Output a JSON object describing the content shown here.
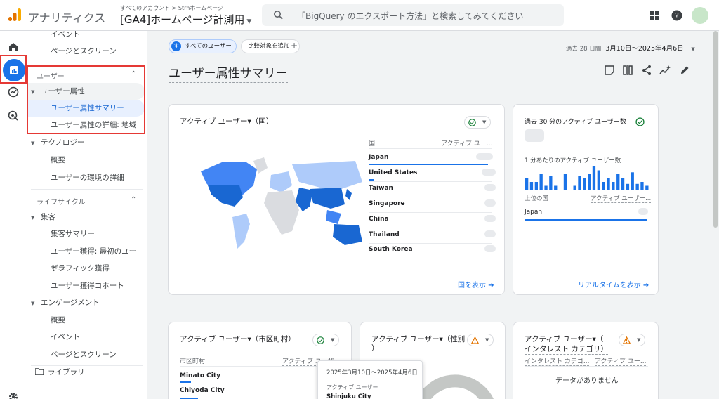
{
  "header": {
    "app_title": "アナリティクス",
    "breadcrumb": "すべてのアカウント > Strhホームページ",
    "property": "[GA4]ホームページ計測用",
    "search_placeholder": "「BigQuery のエクスポート方法」と検索してみてください"
  },
  "nav": {
    "items_top": [
      "イベント",
      "ページとスクリーン"
    ],
    "user_section": "ユーザー",
    "user_attr": "ユーザー属性",
    "user_attr_summary": "ユーザー属性サマリー",
    "user_attr_detail": "ユーザー属性の詳細: 地域",
    "technology": "テクノロジー",
    "tech_overview": "概要",
    "tech_env": "ユーザーの環境の詳細",
    "lifecycle": "ライフサイクル",
    "acquisition": "集客",
    "acq_summary": "集客サマリー",
    "acq_user": "ユーザー獲得: 最初のユーザ...",
    "acq_traffic": "トラフィック獲得",
    "acq_cohort": "ユーザー獲得コホート",
    "engagement": "エンゲージメント",
    "eng_overview": "概要",
    "eng_events": "イベント",
    "eng_pages": "ページとスクリーン",
    "library": "ライブラリ"
  },
  "toolbar": {
    "chip_all_users_letter": "す",
    "chip_all_users": "すべてのユーザー",
    "chip_compare": "比較対象を追加",
    "date_prefix": "過去 28 日間",
    "date_range": "3月10日～2025年4月6日",
    "page_title": "ユーザー属性サマリー"
  },
  "country_card": {
    "title": "アクティブ ユーザー▾（国）",
    "col_country": "国",
    "col_users": "アクティブ ユー...",
    "rows": [
      "Japan",
      "United States",
      "Taiwan",
      "Singapore",
      "China",
      "Thailand",
      "South Korea"
    ],
    "link": "国を表示"
  },
  "realtime_card": {
    "title": "過去 30 分のアクティブ ユーザー数",
    "per_minute": "1 分あたりのアクティブ ユーザー数",
    "col_country": "上位の国",
    "col_users": "アクティブ ユーザー...",
    "row": "Japan",
    "link": "リアルタイムを表示"
  },
  "city_card": {
    "title": "アクティブ ユーザー▾（市区町村）",
    "col_city": "市区町村",
    "col_users": "アクティブ ユーザー",
    "rows": [
      "Minato City",
      "Chiyoda City"
    ]
  },
  "gender_card": {
    "title": "アクティブ ユーザー▾（性別",
    "title2": "）"
  },
  "interest_card": {
    "title": "アクティブ ユーザー▾（",
    "title2": "インタレスト カテゴリ）",
    "col_cat": "インタレスト カテゴ...",
    "col_users": "アクティブ ユー...",
    "empty": "データがありません"
  },
  "tooltip": {
    "date": "2025年3月10日～2025年4月6日",
    "metric": "アクティブ ユーザー",
    "city": "Shinjuku City"
  },
  "colors": {
    "accent": "#1a73e8",
    "highlight": "#e53935"
  },
  "realtime_bars": [
    6,
    4,
    4,
    8,
    2,
    7,
    2,
    0,
    8,
    0,
    2,
    7,
    6,
    8,
    12,
    10,
    4,
    6,
    4,
    8,
    6,
    3,
    9,
    3,
    4,
    2
  ]
}
